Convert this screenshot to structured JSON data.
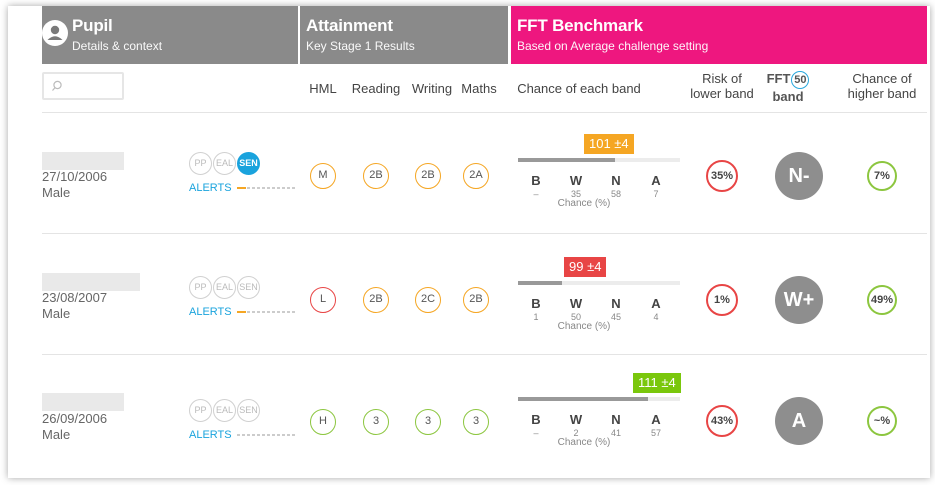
{
  "header": {
    "pupil": {
      "title": "Pupil",
      "subtitle": "Details & context"
    },
    "attainment": {
      "title": "Attainment",
      "subtitle": "Key Stage 1 Results"
    },
    "fft": {
      "title": "FFT Benchmark",
      "subtitle": "Based on Average challenge setting"
    }
  },
  "columns": {
    "hml": "HML",
    "reading": "Reading",
    "writing": "Writing",
    "maths": "Maths",
    "chance_each_band": "Chance of each band",
    "risk_l1": "Risk of",
    "risk_l2": "lower band",
    "fft_band_prefix": "FFT",
    "fft_band_badge": "50",
    "fft_band_l2": "band",
    "higher_l1": "Chance of",
    "higher_l2": "higher band"
  },
  "search": {
    "placeholder": ""
  },
  "colors": {
    "pink": "#ee177f",
    "grey_header": "#8a8a8a",
    "blue": "#1aa3dd",
    "orange": "#f5a623",
    "red": "#e84545",
    "green": "#8cc63f"
  },
  "rows": [
    {
      "dob": "27/10/2006",
      "gender": "Male",
      "flags": [
        "PP",
        "EAL",
        "SEN"
      ],
      "flags_active": [
        false,
        false,
        true
      ],
      "alerts": "ALERTS",
      "hml": "M",
      "reading": "2B",
      "writing": "2B",
      "maths": "2A",
      "benchmark_label": "101 ±4",
      "benchmark_color": "#f5a623",
      "benchmark_fill": 0.6,
      "band_letters": [
        "B",
        "W",
        "N",
        "A"
      ],
      "band_values": [
        "–",
        "35",
        "58",
        "7"
      ],
      "chance_label": "Chance (%)",
      "risk": "35%",
      "band": "N-",
      "higher": "7%"
    },
    {
      "dob": "23/08/2007",
      "gender": "Male",
      "flags": [
        "PP",
        "EAL",
        "SEN"
      ],
      "flags_active": [
        false,
        false,
        false
      ],
      "alerts": "ALERTS",
      "hml": "L",
      "reading": "2B",
      "writing": "2C",
      "maths": "2B",
      "benchmark_label": "99 ±4",
      "benchmark_color": "#e84545",
      "benchmark_fill": 0.27,
      "band_letters": [
        "B",
        "W",
        "N",
        "A"
      ],
      "band_values": [
        "1",
        "50",
        "45",
        "4"
      ],
      "chance_label": "Chance (%)",
      "risk": "1%",
      "band": "W+",
      "higher": "49%"
    },
    {
      "dob": "26/09/2006",
      "gender": "Male",
      "flags": [
        "PP",
        "EAL",
        "SEN"
      ],
      "flags_active": [
        false,
        false,
        false
      ],
      "alerts": "ALERTS",
      "hml": "H",
      "reading": "3",
      "writing": "3",
      "maths": "3",
      "benchmark_label": "111 ±4",
      "benchmark_color": "#7ac70c",
      "benchmark_fill": 0.8,
      "band_letters": [
        "B",
        "W",
        "N",
        "A"
      ],
      "band_values": [
        "–",
        "2",
        "41",
        "57"
      ],
      "chance_label": "Chance (%)",
      "risk": "43%",
      "band": "A",
      "higher": "~%"
    }
  ]
}
